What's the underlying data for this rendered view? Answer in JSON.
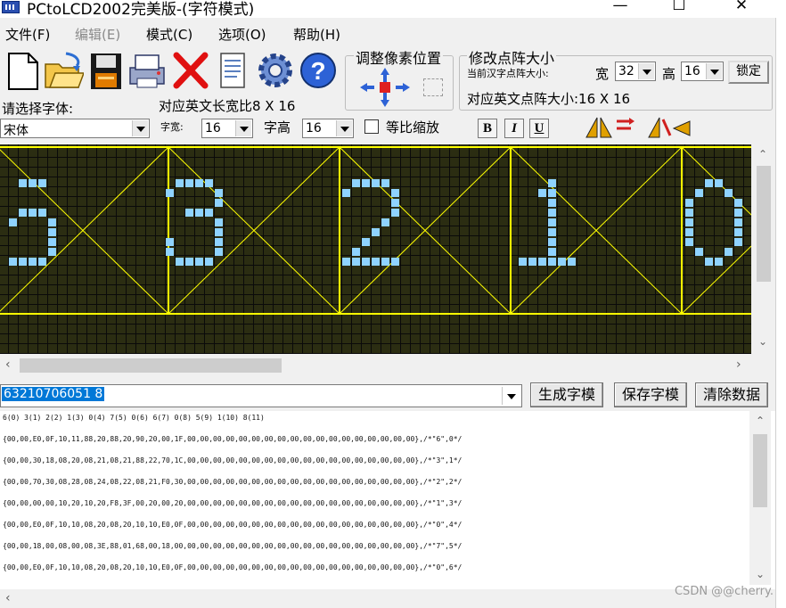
{
  "window": {
    "title": "PCtoLCD2002完美版-(字符模式)"
  },
  "menu": [
    "文件(F)",
    "编辑(E)",
    "模式(C)",
    "选项(O)",
    "帮助(H)"
  ],
  "group_adjust": {
    "title": "调整像素位置"
  },
  "group_size": {
    "title": "修改点阵大小",
    "current_label": "当前汉字点阵大小:",
    "width_label": "宽",
    "width_value": "32",
    "height_label": "高",
    "height_value": "16",
    "lock_label": "锁定",
    "english_size_text": "对应英文点阵大小:16 X 16"
  },
  "font": {
    "select_label": "请选择字体:",
    "font_value": "宋体",
    "english_ratio_text": "对应英文长宽比8 X 16",
    "char_width_label": "字宽:",
    "char_width_value": "16",
    "char_height_label": "字高",
    "char_height_value": "16",
    "proportional_label": "等比缩放"
  },
  "format_buttons": [
    "B",
    "I",
    "U"
  ],
  "lcd": {
    "characters": [
      "6",
      "3",
      "2",
      "1",
      "0"
    ],
    "pixel_color": "#8fd3ff",
    "guide_color": "#ffff00",
    "background_color": "#2b2d12"
  },
  "input": {
    "text": "63210706051 8"
  },
  "buttons": {
    "generate": "生成字模",
    "save": "保存字模",
    "clear": "清除数据"
  },
  "output": {
    "index_header": "6(0) 3(1) 2(2) 1(3) 0(4) 7(5) 0(6) 6(7) 0(8) 5(9) 1(10) 8(11)",
    "lines": [
      "{00,00,E0,0F,10,11,88,20,88,20,90,20,00,1F,00,00,00,00,00,00,00,00,00,00,00,00,00,00,00,00,00,00},/*\"6\",0*/",
      "{00,00,30,18,08,20,08,21,08,21,88,22,70,1C,00,00,00,00,00,00,00,00,00,00,00,00,00,00,00,00,00,00},/*\"3\",1*/",
      "{00,00,70,30,08,28,08,24,08,22,08,21,F0,30,00,00,00,00,00,00,00,00,00,00,00,00,00,00,00,00,00,00},/*\"2\",2*/",
      "{00,00,00,00,10,20,10,20,F8,3F,00,20,00,20,00,00,00,00,00,00,00,00,00,00,00,00,00,00,00,00,00,00},/*\"1\",3*/",
      "{00,00,E0,0F,10,10,08,20,08,20,10,10,E0,0F,00,00,00,00,00,00,00,00,00,00,00,00,00,00,00,00,00,00},/*\"0\",4*/",
      "{00,00,18,00,08,00,08,3E,88,01,68,00,18,00,00,00,00,00,00,00,00,00,00,00,00,00,00,00,00,00,00,00},/*\"7\",5*/",
      "{00,00,E0,0F,10,10,08,20,08,20,10,10,E0,0F,00,00,00,00,00,00,00,00,00,00,00,00,00,00,00,00,00,00},/*\"0\",6*/"
    ]
  },
  "watermark": "CSDN @@cherry."
}
